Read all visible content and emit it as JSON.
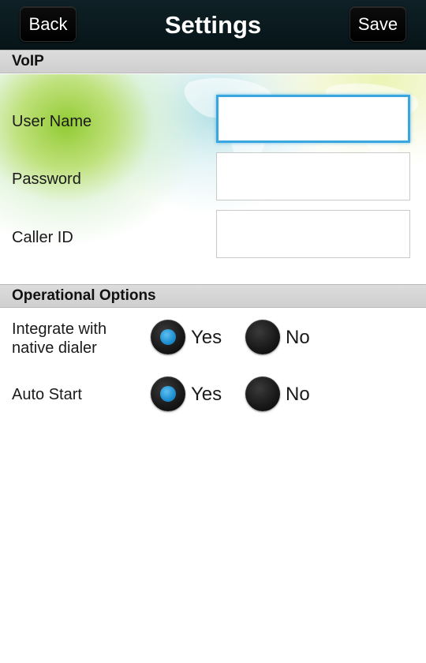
{
  "header": {
    "title": "Settings",
    "back_label": "Back",
    "save_label": "Save"
  },
  "voip": {
    "section_title": "VoIP",
    "fields": [
      {
        "label": "User Name",
        "value": "",
        "focused": true
      },
      {
        "label": "Password",
        "value": ""
      },
      {
        "label": "Caller ID",
        "value": ""
      }
    ]
  },
  "operational": {
    "section_title": "Operational Options",
    "options": [
      {
        "label_line1": "Integrate with",
        "label_line2": "native dialer",
        "yes_label": "Yes",
        "no_label": "No",
        "selected": "Yes"
      },
      {
        "label_line1": "Auto Start",
        "yes_label": "Yes",
        "no_label": "No",
        "selected": "Yes"
      }
    ]
  },
  "colors": {
    "accent": "#3aa6df",
    "topbar": "#0b1b20",
    "section_header": "#d6d6d6"
  }
}
